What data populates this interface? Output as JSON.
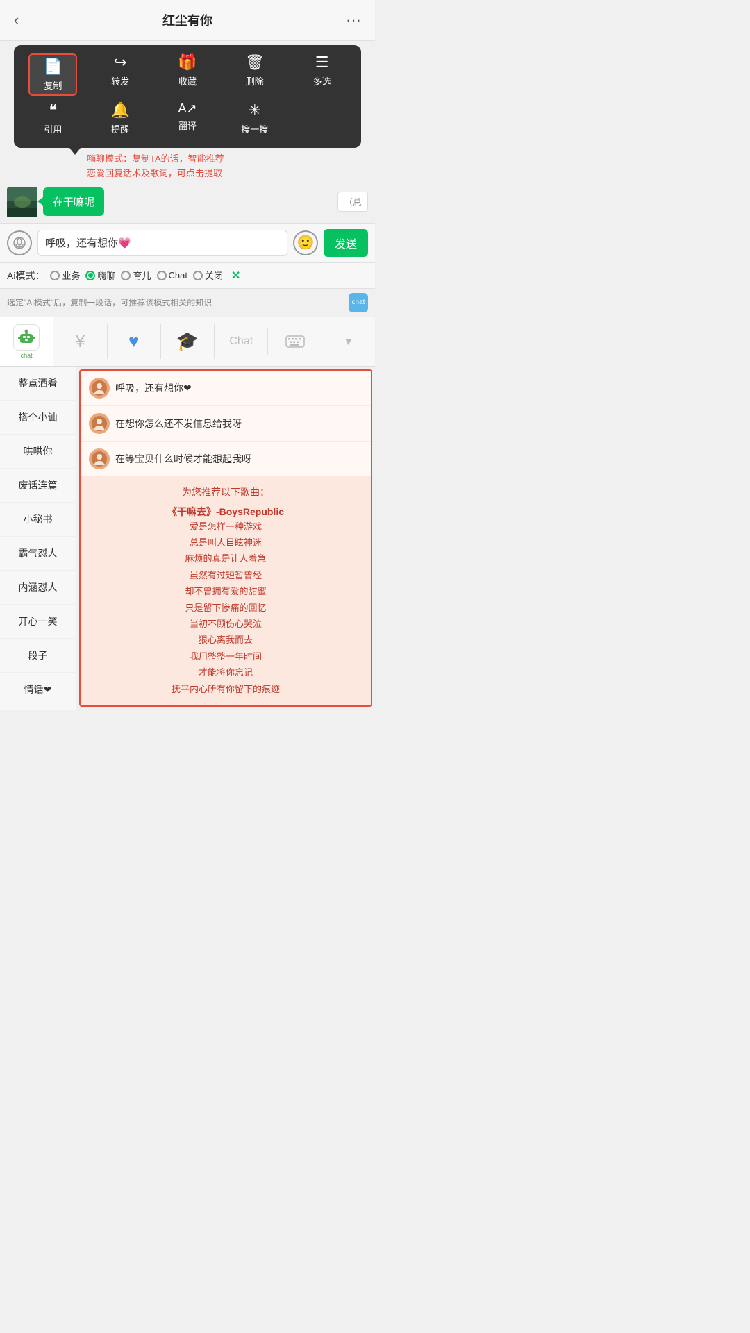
{
  "nav": {
    "title": "红尘有你",
    "back": "‹",
    "more": "···"
  },
  "contextMenu": {
    "row1": [
      {
        "icon": "📄",
        "label": "复制",
        "highlighted": true
      },
      {
        "icon": "↪",
        "label": "转发"
      },
      {
        "icon": "🎁",
        "label": "收藏"
      },
      {
        "icon": "🗑",
        "label": "删除"
      },
      {
        "icon": "☰",
        "label": "多选"
      }
    ],
    "row2": [
      {
        "icon": "❝",
        "label": "引用"
      },
      {
        "icon": "🔔",
        "label": "提醒"
      },
      {
        "icon": "A→",
        "label": "翻译"
      },
      {
        "icon": "✳",
        "label": "搜一搜"
      }
    ]
  },
  "annotation": {
    "text": "嗨聊模式：复制TA的话，智能推荐\n恋爱回复话术及歌词，可点击提取"
  },
  "chatBubble": {
    "text": "在干嘛呢"
  },
  "inputArea": {
    "value": "呼吸，还有想你💗",
    "sendLabel": "发送",
    "placeholder": "呼吸，还有想你💗"
  },
  "aiModeBar": {
    "label": "Ai模式：",
    "options": [
      {
        "id": "yewu",
        "label": "业务",
        "selected": false
      },
      {
        "id": "haijiao",
        "label": "嗨聊",
        "selected": true
      },
      {
        "id": "yuer",
        "label": "育儿",
        "selected": false
      },
      {
        "id": "chat",
        "label": "Chat",
        "selected": false
      },
      {
        "id": "guanbi",
        "label": "关闭",
        "selected": false
      }
    ],
    "closeLabel": "✕"
  },
  "aiHint": {
    "text": "选定\"Ai模式\"后，复制一段话，可推荐该模式相关的知识"
  },
  "funcBar": {
    "items": [
      {
        "id": "robot",
        "icon": "robot",
        "label": "chat"
      },
      {
        "id": "yen",
        "icon": "¥"
      },
      {
        "id": "heart",
        "icon": "♥"
      },
      {
        "id": "grad",
        "icon": "🎓"
      },
      {
        "id": "chat-text",
        "icon": "Chat"
      },
      {
        "id": "keyboard",
        "icon": "⌨"
      },
      {
        "id": "arrow-down",
        "icon": "▼"
      }
    ]
  },
  "sidebar": {
    "items": [
      {
        "label": "整点酒肴"
      },
      {
        "label": "搭个小讪"
      },
      {
        "label": "哄哄你"
      },
      {
        "label": "废话连篇"
      },
      {
        "label": "小秘书"
      },
      {
        "label": "霸气怼人"
      },
      {
        "label": "内涵怼人"
      },
      {
        "label": "开心一笑"
      },
      {
        "label": "段子"
      },
      {
        "label": "情话❤"
      }
    ]
  },
  "responses": [
    {
      "text": "呼吸，还有想你❤"
    },
    {
      "text": "在想你怎么还不发信息给我呀"
    },
    {
      "text": "在等宝贝什么时候才能想起我呀"
    }
  ],
  "songRec": {
    "title": "为您推荐以下歌曲：",
    "songTitle": "《干嘛去》-BoysRepublic",
    "lyrics": [
      "爱是怎样一种游戏",
      "总是叫人目眩神迷",
      "麻烦的真是让人着急",
      "虽然有过短暂曾经",
      "却不曾拥有爱的甜蜜",
      "只是留下惨痛的回忆",
      "当初不顾伤心哭泣",
      "狠心离我而去",
      "我用整整一年时间",
      "才能将你忘记",
      "抚平内心所有你留下的痕迹"
    ]
  }
}
